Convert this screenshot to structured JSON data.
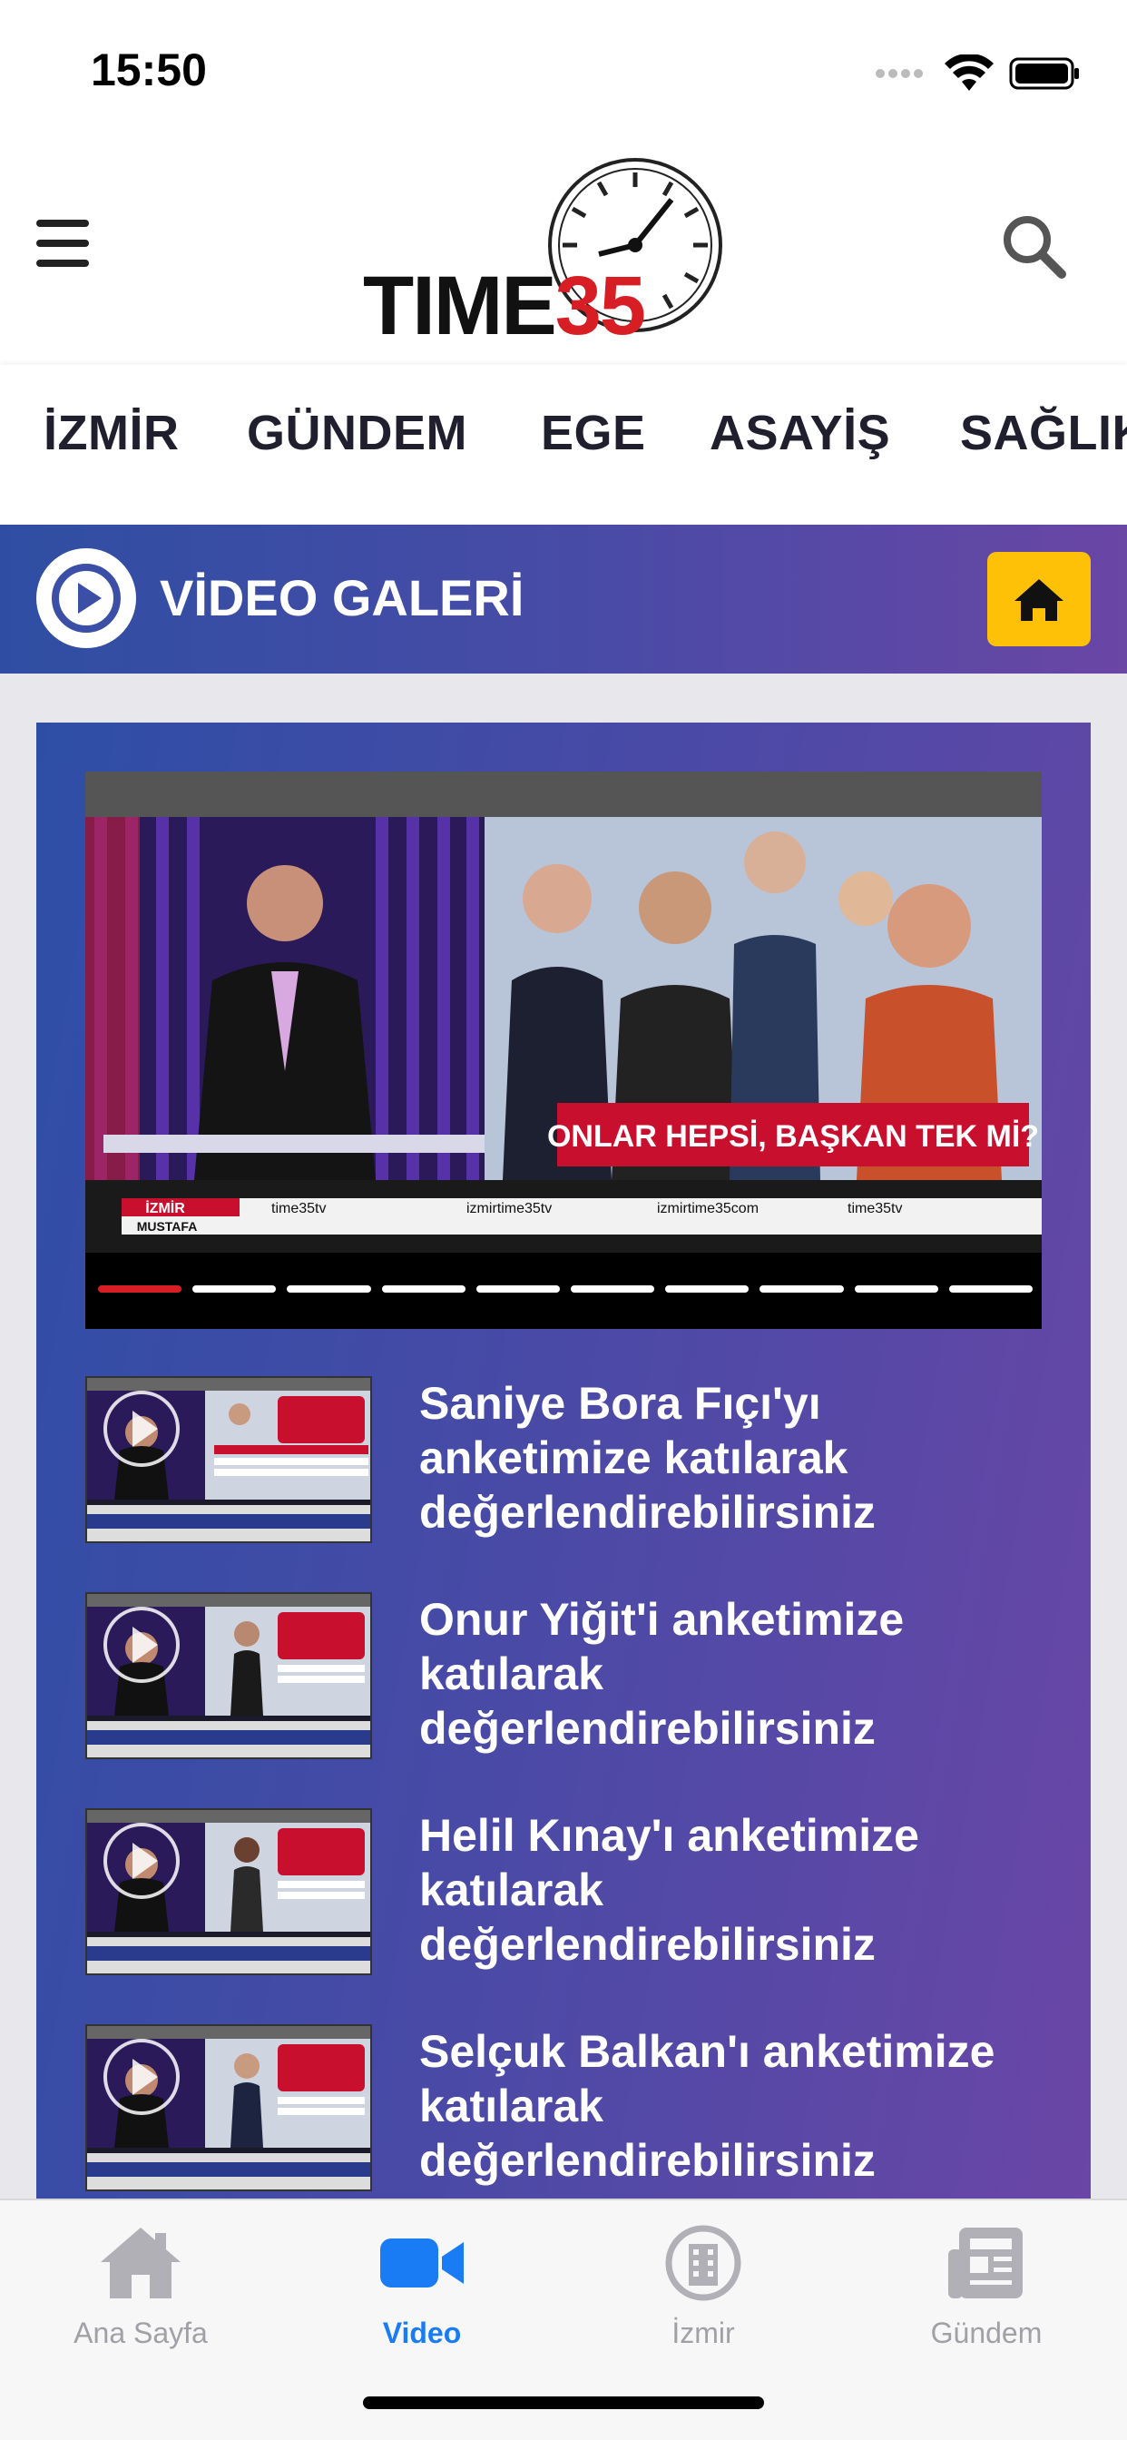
{
  "status_bar": {
    "time": "15:50"
  },
  "header": {
    "logo_text_main": "TIME",
    "logo_text_number": "35"
  },
  "categories": [
    "İZMİR",
    "GÜNDEM",
    "EGE",
    "ASAYİŞ",
    "SAĞLIK"
  ],
  "section": {
    "title": "VİDEO GALERİ"
  },
  "slider": {
    "headline": "ONLAR HEPSİ, BAŞKAN TEK Mİ?",
    "ticker_city": "İZMİR",
    "ticker_name": "MUSTAFA",
    "socials": [
      "time35tv",
      "izmirtime35tv",
      "izmirtime35com",
      "time35tv"
    ],
    "dot_count": 10,
    "active_dot": 0
  },
  "videos": [
    {
      "title": "Saniye Bora Fıçı'yı anketimize katılarak değerlendirebilirsiniz"
    },
    {
      "title": "Onur Yiğit'i anketimize katılarak değerlendirebilirsiniz"
    },
    {
      "title": "Helil Kınay'ı anketimize katılarak değerlendirebilirsiniz"
    },
    {
      "title": "Selçuk Balkan'ı anketimize katılarak değerlendirebilirsiniz"
    }
  ],
  "tabs": [
    {
      "label": "Ana Sayfa",
      "icon": "home-icon"
    },
    {
      "label": "Video",
      "icon": "video-camera-icon",
      "active": true
    },
    {
      "label": "İzmir",
      "icon": "building-icon"
    },
    {
      "label": "Gündem",
      "icon": "newspaper-icon"
    }
  ],
  "colors": {
    "brand_red": "#d81e25",
    "accent_blue": "#1a7cf5",
    "banner_start": "#2f4ea3",
    "banner_end": "#6a46a5",
    "home_button": "#ffc107"
  }
}
